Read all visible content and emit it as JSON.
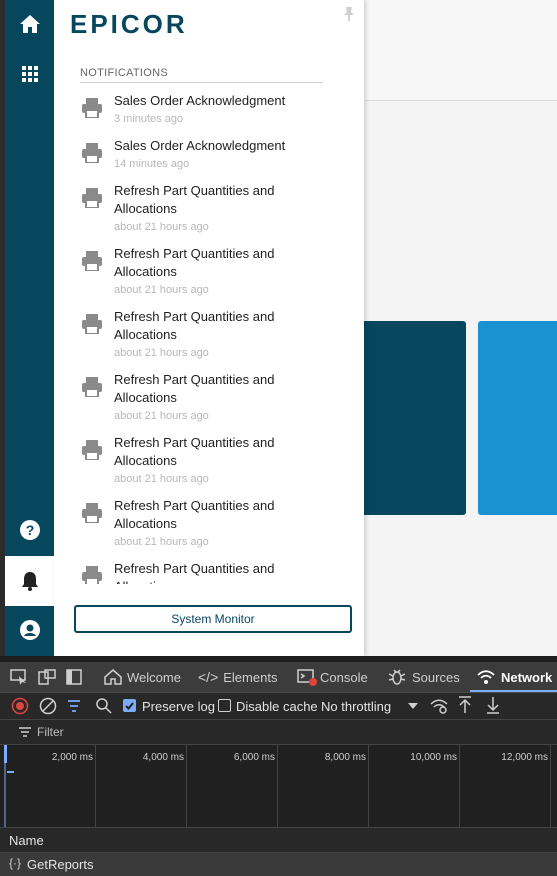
{
  "app": {
    "logo_text": "EPICOR",
    "nav": {
      "home_icon": "home-icon",
      "apps_icon": "grid-icon",
      "help_icon": "help-icon",
      "notifications_icon": "bell-icon",
      "account_icon": "user-icon"
    },
    "notifications": {
      "header": "NOTIFICATIONS",
      "items": [
        {
          "title": "Sales Order Acknowledgment",
          "time": "3 minutes ago"
        },
        {
          "title": "Sales Order Acknowledgment",
          "time": "14 minutes ago"
        },
        {
          "title": "Refresh Part Quantities and Allocations",
          "time": "about 21 hours ago"
        },
        {
          "title": "Refresh Part Quantities and Allocations",
          "time": "about 21 hours ago"
        },
        {
          "title": "Refresh Part Quantities and Allocations",
          "time": "about 21 hours ago"
        },
        {
          "title": "Refresh Part Quantities and Allocations",
          "time": "about 21 hours ago"
        },
        {
          "title": "Refresh Part Quantities and Allocations",
          "time": "about 21 hours ago"
        },
        {
          "title": "Refresh Part Quantities and Allocations",
          "time": "about 21 hours ago"
        },
        {
          "title": "Refresh Part Quantities and Allocations",
          "time": ""
        }
      ],
      "system_monitor_label": "System Monitor"
    },
    "colors": {
      "brand": "#06475e",
      "accent_blue": "#1a92d2"
    }
  },
  "devtools": {
    "tabs": {
      "welcome": "Welcome",
      "elements": "Elements",
      "console": "Console",
      "sources": "Sources",
      "network": "Network"
    },
    "toolbar": {
      "preserve_log": "Preserve log",
      "preserve_log_checked": true,
      "disable_cache": "Disable cache",
      "disable_cache_checked": false,
      "throttling": "No throttling"
    },
    "filter_label": "Filter",
    "timeline_ticks": [
      "2,000 ms",
      "4,000 ms",
      "6,000 ms",
      "8,000 ms",
      "10,000 ms",
      "12,000 ms"
    ],
    "table": {
      "name_header": "Name",
      "rows": [
        {
          "name": "GetReports"
        }
      ]
    }
  }
}
